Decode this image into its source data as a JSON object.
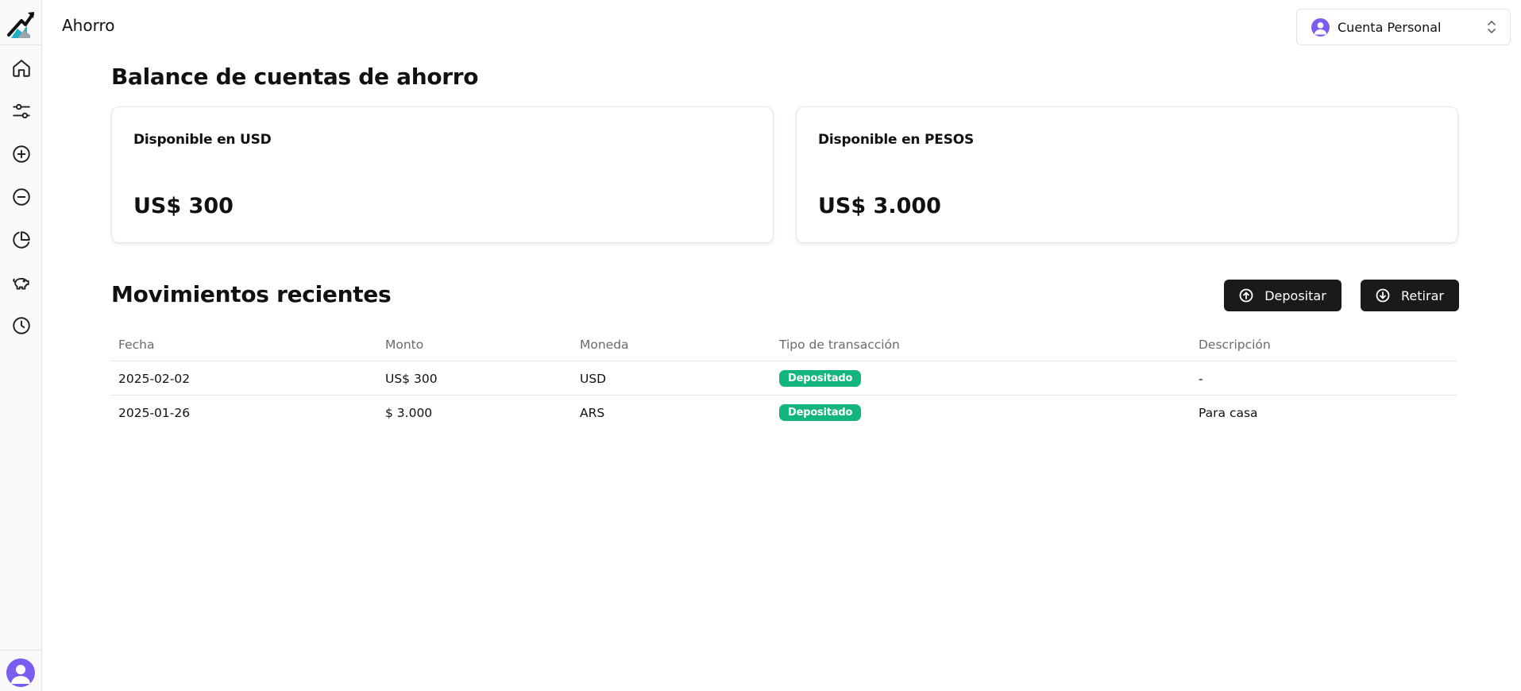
{
  "app": {
    "page_title": "Ahorro"
  },
  "sidebar": {
    "items": [
      {
        "icon": "home-icon"
      },
      {
        "icon": "sliders-icon"
      },
      {
        "icon": "plus-circle-icon"
      },
      {
        "icon": "minus-circle-icon"
      },
      {
        "icon": "pie-chart-icon"
      },
      {
        "icon": "piggy-bank-icon"
      },
      {
        "icon": "clock-icon"
      }
    ]
  },
  "account": {
    "label": "Cuenta Personal"
  },
  "balances": {
    "title": "Balance de cuentas de ahorro",
    "usd": {
      "label": "Disponible en USD",
      "value": "US$ 300"
    },
    "pesos": {
      "label": "Disponible en PESOS",
      "value": "US$ 3.000"
    }
  },
  "movements": {
    "title": "Movimientos recientes",
    "deposit_label": "Depositar",
    "withdraw_label": "Retirar",
    "columns": [
      "Fecha",
      "Monto",
      "Moneda",
      "Tipo de transacción",
      "Descripción"
    ],
    "rows": [
      {
        "date": "2025-02-02",
        "amount": "US$ 300",
        "currency": "USD",
        "type": "Depositado",
        "description": "-"
      },
      {
        "date": "2025-01-26",
        "amount": "$ 3.000",
        "currency": "ARS",
        "type": "Depositado",
        "description": "Para casa"
      }
    ]
  },
  "colors": {
    "accent_dark": "#1a1a1a",
    "badge_green": "#12b57c",
    "avatar_purple": "#7b5cf0"
  }
}
